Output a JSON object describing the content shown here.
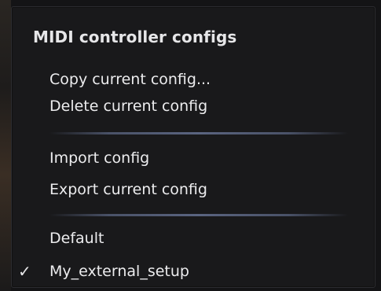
{
  "menu": {
    "header": "MIDI controller configs",
    "items": [
      {
        "label": "Copy current config..."
      },
      {
        "label": "Delete current config"
      },
      {
        "label": "Import config"
      },
      {
        "label": "Export current config"
      },
      {
        "label": "Default"
      },
      {
        "label": "My_external_setup",
        "checked": true
      }
    ],
    "check_glyph": "✓"
  },
  "colors": {
    "menu_background": "#19191b",
    "text": "#ececee",
    "separator": "#5a6480"
  }
}
